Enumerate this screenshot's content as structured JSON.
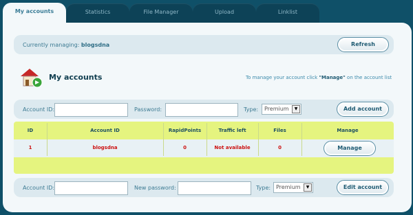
{
  "tabs": [
    {
      "label": "My accounts",
      "active": true
    },
    {
      "label": "Statistics"
    },
    {
      "label": "File Manager"
    },
    {
      "label": "Upload"
    },
    {
      "label": "Linklist"
    }
  ],
  "managing": {
    "prefix": "Currently managing:",
    "account": "blogsdna"
  },
  "refresh_label": "Refresh",
  "section": {
    "title": "My accounts",
    "hint_before": "To manage your account click ",
    "hint_bold": "\"Manage\"",
    "hint_after": " on the account list"
  },
  "add_form": {
    "account_id_label": "Account ID:",
    "account_id_value": "",
    "password_label": "Password:",
    "password_value": "",
    "type_label": "Type:",
    "type_value": "Premium",
    "button": "Add account"
  },
  "table": {
    "headers": [
      "ID",
      "Account ID",
      "RapidPoints",
      "Traffic left",
      "Files",
      "Manage"
    ],
    "rows": [
      {
        "id": "1",
        "account": "blogsdna",
        "rapidpoints": "0",
        "traffic": "Not available",
        "files": "0",
        "manage": "Manage"
      }
    ]
  },
  "edit_form": {
    "account_id_label": "Account ID:",
    "account_id_value": "",
    "password_label": "New password:",
    "password_value": "",
    "type_label": "Type:",
    "type_value": "Premium",
    "button": "Edit account"
  },
  "colors": {
    "background": "#0f5068",
    "panel": "#f3f8fa",
    "table": "#e5f47f",
    "value_red": "#cc1111"
  }
}
